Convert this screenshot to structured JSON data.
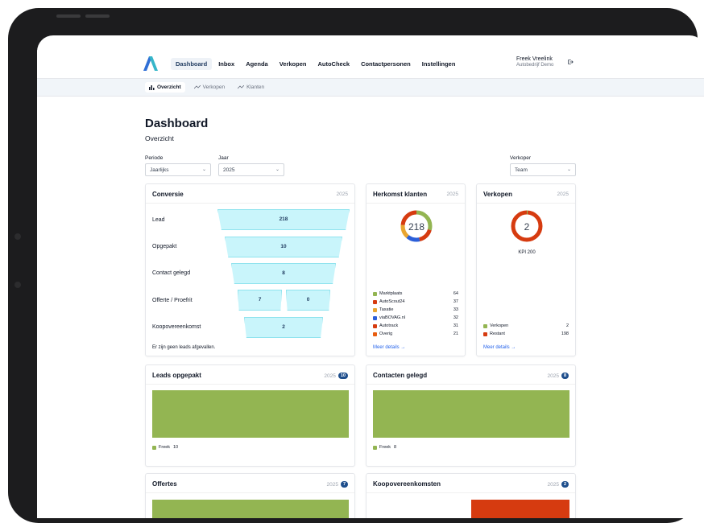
{
  "nav": {
    "items": [
      "Dashboard",
      "Inbox",
      "Agenda",
      "Verkopen",
      "AutoCheck",
      "Contactpersonen",
      "Instellingen"
    ],
    "user_name": "Freek Vreelink",
    "user_org": "Autobedrijf Demo"
  },
  "subnav": {
    "items": [
      "Overzicht",
      "Verkopen",
      "Klanten"
    ]
  },
  "page": {
    "title": "Dashboard",
    "subtitle": "Overzicht"
  },
  "filters": {
    "periode_label": "Periode",
    "periode_value": "Jaarlijks",
    "jaar_label": "Jaar",
    "jaar_value": "2025",
    "verkoper_label": "Verkoper",
    "verkoper_value": "Team"
  },
  "conversie": {
    "title": "Conversie",
    "year": "2025",
    "rows": [
      {
        "label": "Lead",
        "value": "218"
      },
      {
        "label": "Opgepakt",
        "value": "10"
      },
      {
        "label": "Contact gelegd",
        "value": "8"
      },
      {
        "label": "Offerte / Proefrit",
        "value": "7",
        "value2": "0"
      },
      {
        "label": "Koopovereenkomst",
        "value": "2"
      }
    ],
    "note": "Er zijn geen leads afgevallen."
  },
  "herkomst": {
    "title": "Herkomst klanten",
    "year": "2025",
    "total": "218",
    "items": [
      {
        "name": "Marktplaats",
        "value": "64",
        "color": "#93b552"
      },
      {
        "name": "AutoScout24",
        "value": "37",
        "color": "#d63b10"
      },
      {
        "name": "Taxatie",
        "value": "33",
        "color": "#e8a531"
      },
      {
        "name": "viaBOVAG.nl",
        "value": "32",
        "color": "#2b5fd9"
      },
      {
        "name": "Autotrack",
        "value": "31",
        "color": "#d63b10"
      },
      {
        "name": "Overig",
        "value": "21",
        "color": "#e85d10"
      }
    ],
    "more": "Meer details →"
  },
  "verkopen": {
    "title": "Verkopen",
    "year": "2025",
    "total": "2",
    "kpi": "KPI 200",
    "items": [
      {
        "name": "Verkopen",
        "value": "2",
        "color": "#93b552"
      },
      {
        "name": "Restant",
        "value": "198",
        "color": "#d63b10"
      }
    ],
    "more": "Meer details →"
  },
  "leads_opgepakt": {
    "title": "Leads opgepakt",
    "year": "2025",
    "badge": "10",
    "legend_name": "Freek",
    "legend_value": "10"
  },
  "contacten_gelegd": {
    "title": "Contacten gelegd",
    "year": "2025",
    "badge": "8",
    "legend_name": "Freek",
    "legend_value": "8"
  },
  "offertes": {
    "title": "Offertes",
    "year": "2025",
    "badge": "7"
  },
  "koopovereenkomsten": {
    "title": "Koopovereenkomsten",
    "year": "2025",
    "badge": "2"
  },
  "colors": {
    "accent": "#1e4e8c",
    "green": "#93b552",
    "red": "#d63b10",
    "funnel": "#c9f5fb"
  }
}
